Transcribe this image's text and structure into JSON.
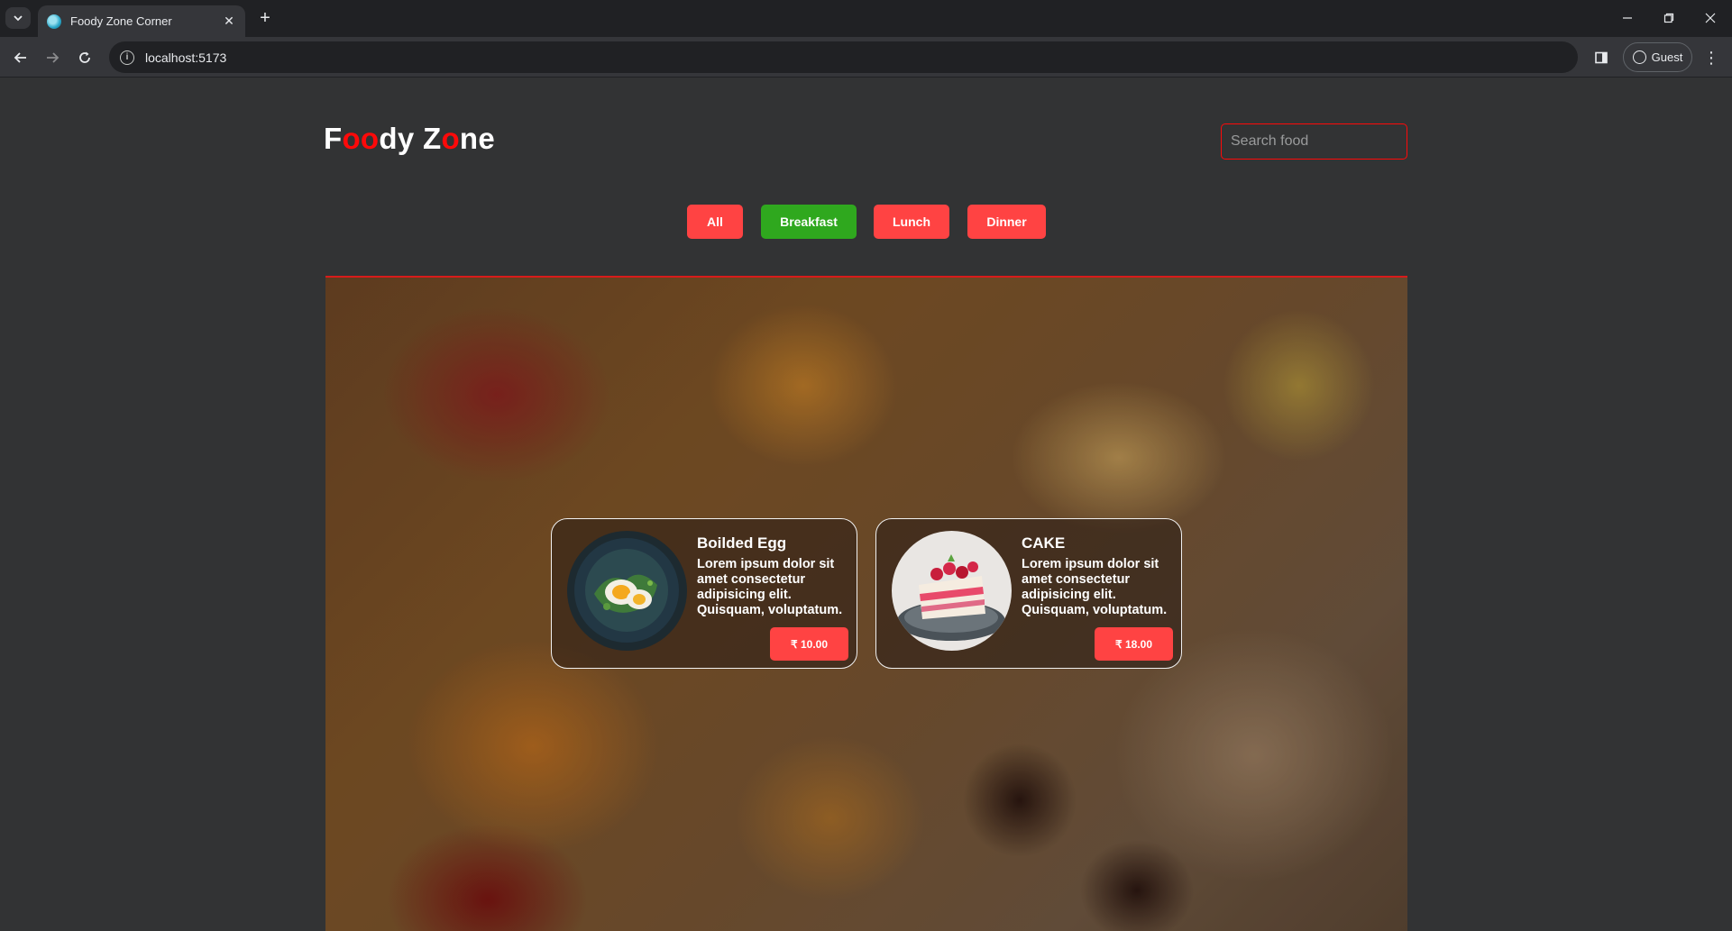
{
  "browser": {
    "tab_title": "Foody Zone Corner",
    "url": "localhost:5173",
    "profile_label": "Guest"
  },
  "header": {
    "logo_parts": [
      "F",
      "oo",
      "dy Z",
      "o",
      "ne"
    ],
    "search_placeholder": "Search food"
  },
  "filters": [
    {
      "label": "All",
      "active": false
    },
    {
      "label": "Breakfast",
      "active": true
    },
    {
      "label": "Lunch",
      "active": false
    },
    {
      "label": "Dinner",
      "active": false
    }
  ],
  "foods": [
    {
      "name": "Boilded Egg",
      "description": "Lorem ipsum dolor sit amet consectetur adipisicing elit. Quisquam, voluptatum.",
      "price": "₹ 10.00",
      "image_icon": "boiled-egg-plate-image"
    },
    {
      "name": "CAKE",
      "description": "Lorem ipsum dolor sit amet consectetur adipisicing elit. Quisquam, voluptatum.",
      "price": "₹ 18.00",
      "image_icon": "cake-slice-image"
    }
  ],
  "colors": {
    "accent": "#ff4343",
    "active_filter": "#2fa81e",
    "brand_red": "#ff0909",
    "background": "#323334"
  }
}
